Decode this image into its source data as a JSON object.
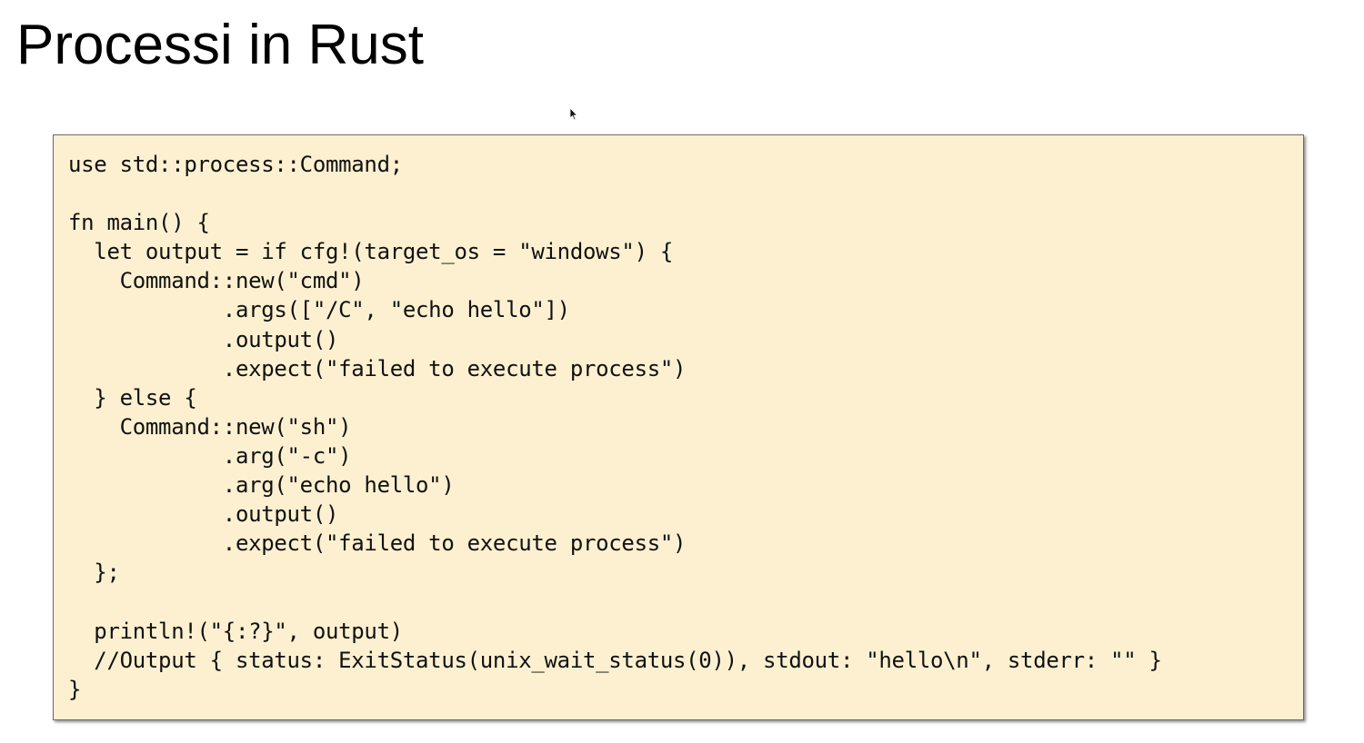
{
  "slide": {
    "title": "Processi in Rust"
  },
  "code": {
    "language": "rust",
    "lines": [
      "use std::process::Command;",
      "",
      "fn main() {",
      "  let output = if cfg!(target_os = \"windows\") {",
      "    Command::new(\"cmd\")",
      "            .args([\"/C\", \"echo hello\"])",
      "            .output()",
      "            .expect(\"failed to execute process\")",
      "  } else {",
      "    Command::new(\"sh\")",
      "            .arg(\"-c\")",
      "            .arg(\"echo hello\")",
      "            .output()",
      "            .expect(\"failed to execute process\")",
      "  };",
      "",
      "  println!(\"{:?}\", output)",
      "  //Output { status: ExitStatus(unix_wait_status(0)), stdout: \"hello\\n\", stderr: \"\" }",
      "}"
    ]
  },
  "icons": {
    "cursor": "mouse-pointer-icon"
  },
  "colors": {
    "background": "#ffffff",
    "code_background": "#fcf0d0",
    "code_border": "#6b6b6b",
    "text": "#000000"
  }
}
